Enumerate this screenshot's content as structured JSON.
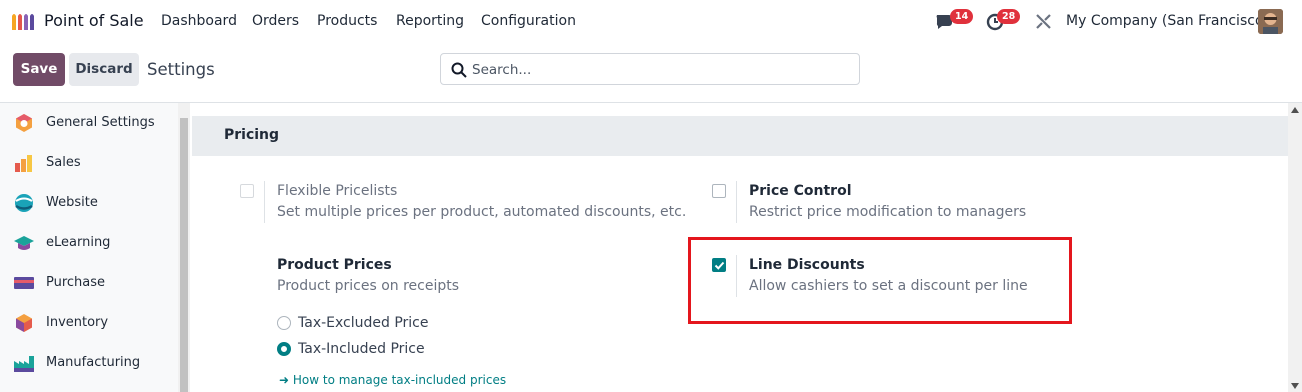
{
  "nav": {
    "app_name": "Point of Sale",
    "menu": [
      "Dashboard",
      "Orders",
      "Products",
      "Reporting",
      "Configuration"
    ],
    "messages_badge": "14",
    "activities_badge": "28",
    "company": "My Company (San Francisco)"
  },
  "control": {
    "save_label": "Save",
    "discard_label": "Discard",
    "breadcrumb": "Settings",
    "search_placeholder": "Search..."
  },
  "sidebar": {
    "items": [
      {
        "label": "General Settings",
        "icon": "general-settings-icon"
      },
      {
        "label": "Sales",
        "icon": "sales-icon"
      },
      {
        "label": "Website",
        "icon": "website-icon"
      },
      {
        "label": "eLearning",
        "icon": "elearning-icon"
      },
      {
        "label": "Purchase",
        "icon": "purchase-icon"
      },
      {
        "label": "Inventory",
        "icon": "inventory-icon"
      },
      {
        "label": "Manufacturing",
        "icon": "manufacturing-icon"
      }
    ]
  },
  "section": {
    "title": "Pricing",
    "flexible": {
      "title": "Flexible Pricelists",
      "desc": "Set multiple prices per product, automated discounts, etc.",
      "checked": false
    },
    "price_control": {
      "title": "Price Control",
      "desc": "Restrict price modification to managers",
      "checked": false
    },
    "product_prices": {
      "title": "Product Prices",
      "desc": "Product prices on receipts"
    },
    "tax_options": [
      "Tax-Excluded Price",
      "Tax-Included Price"
    ],
    "selected_tax_option": "Tax-Included Price",
    "tax_link": "How to manage tax-included prices",
    "line_discounts": {
      "title": "Line Discounts",
      "desc": "Allow cashiers to set a discount per line",
      "checked": true
    }
  },
  "colors": {
    "primary": "#714b67",
    "accent": "#017e84",
    "highlight": "#e4161d",
    "badge": "#e0313c"
  }
}
